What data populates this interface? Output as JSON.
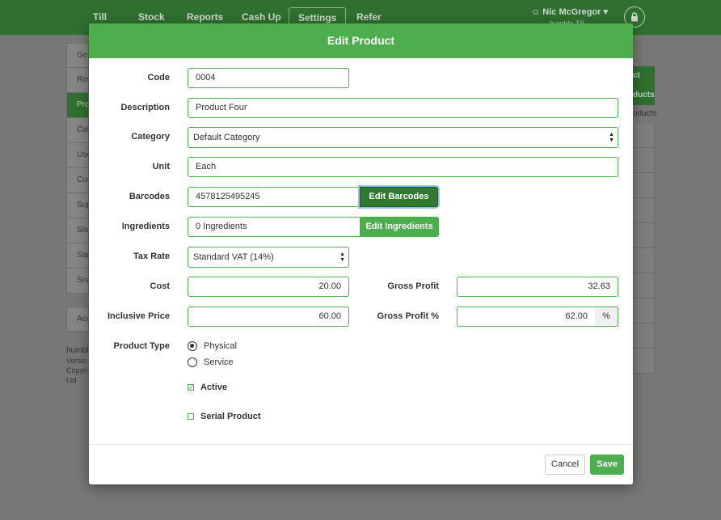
{
  "topnav": {
    "items": [
      "Till",
      "Stock",
      "Reports",
      "Cash Up",
      "Settings",
      "Refer"
    ],
    "active": "Settings",
    "user_name": "Nic McGregor",
    "user_sub": "humble Till"
  },
  "background": {
    "sidebar_items": [
      "Gen",
      "Rec",
      "Pro",
      "Cat",
      "Use",
      "Cus",
      "Sup",
      "Site",
      "Sag",
      "Sna"
    ],
    "sidebar_active": "Pro",
    "sidebar_extra": "Acc",
    "info_lines": [
      "humbl",
      "Versio",
      "Copyri",
      "Ltd"
    ],
    "right_button_lines": [
      "ct",
      "ducts"
    ],
    "right_text": "oducts"
  },
  "modal": {
    "title": "Edit Product",
    "labels": {
      "code": "Code",
      "description": "Description",
      "category": "Category",
      "unit": "Unit",
      "barcodes": "Barcodes",
      "ingredients": "Ingredients",
      "tax_rate": "Tax Rate",
      "cost": "Cost",
      "inclusive_price": "Inclusive Price",
      "gross_profit": "Gross Profit",
      "gross_profit_pct": "Gross Profit %",
      "product_type": "Product Type"
    },
    "values": {
      "code": "0004",
      "description": "Product Four",
      "category": "Default Category",
      "unit": "Each",
      "barcodes": "4578125495245",
      "ingredients": "0 Ingredients",
      "tax_rate": "Standard VAT (14%)",
      "cost": "20.00",
      "inclusive_price": "60.00",
      "gross_profit": "32.63",
      "gross_profit_pct": "62.00",
      "pct_addon": "%"
    },
    "buttons": {
      "edit_barcodes": "Edit Barcodes",
      "edit_ingredients": "Edit Ingredients",
      "cancel": "Cancel",
      "save": "Save"
    },
    "product_type_options": [
      "Physical",
      "Service"
    ],
    "product_type_selected": "Physical",
    "checkboxes": {
      "active_label": "Active",
      "active_checked": true,
      "serial_label": "Serial Product",
      "serial_checked": false
    },
    "colors": {
      "accent": "#4cae4c",
      "accent_dark": "#2f7a2f"
    }
  }
}
